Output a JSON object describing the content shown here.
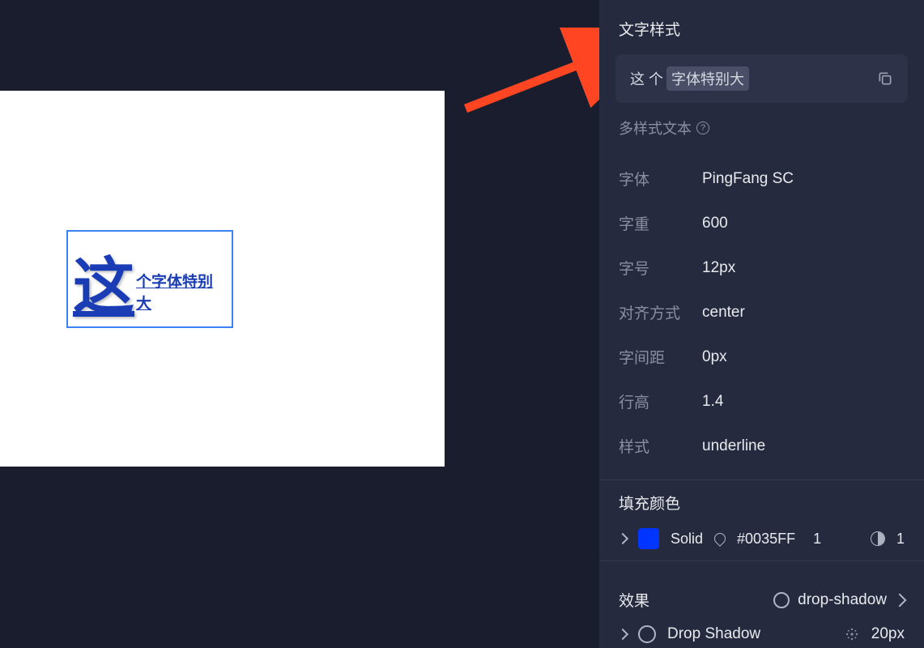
{
  "canvas": {
    "big_char": "这",
    "small_text": "个字体特别大"
  },
  "panel": {
    "text_style_title": "文字样式",
    "text_chip_1": "这 个",
    "text_chip_2": "字体特别大",
    "multi_style_label": "多样式文本",
    "props": {
      "font_label": "字体",
      "font_value": "PingFang SC",
      "weight_label": "字重",
      "weight_value": "600",
      "size_label": "字号",
      "size_value": "12px",
      "align_label": "对齐方式",
      "align_value": "center",
      "letter_label": "字间距",
      "letter_value": "0px",
      "lineheight_label": "行高",
      "lineheight_value": "1.4",
      "style_label": "样式",
      "style_value": "underline"
    },
    "fill_title": "填充颜色",
    "fill_type": "Solid",
    "fill_hex": "#0035FF",
    "fill_opacity": "1",
    "fill_count": "1",
    "effects_title": "效果",
    "drop_shadow_tag": "drop-shadow",
    "drop_shadow_name": "Drop Shadow",
    "drop_shadow_blur": "20px"
  }
}
